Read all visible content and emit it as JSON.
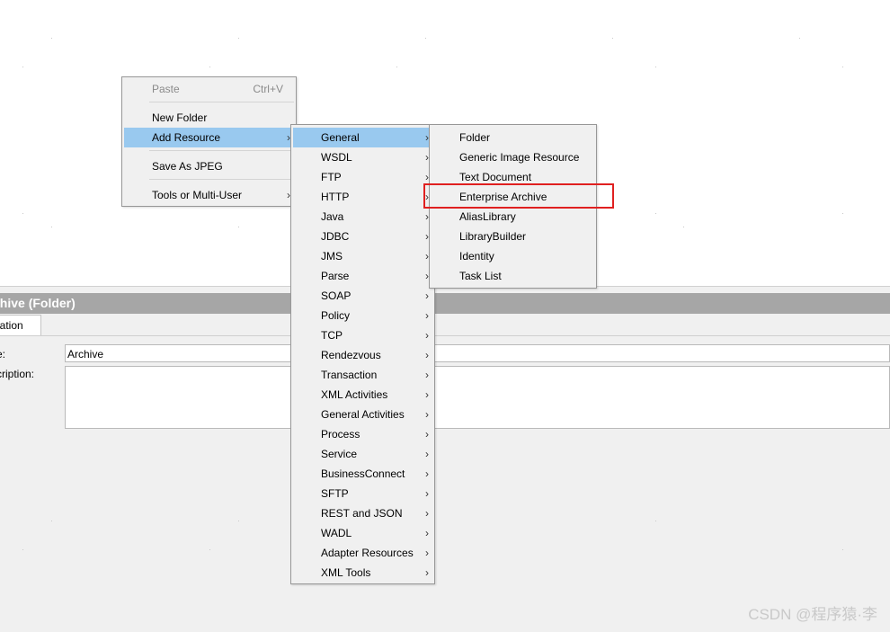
{
  "context_menu": {
    "paste": {
      "label": "Paste",
      "shortcut": "Ctrl+V"
    },
    "new_folder": "New Folder",
    "add_resource": "Add Resource",
    "save_as_jpeg": "Save As JPEG",
    "tools_multi_user": "Tools or Multi-User"
  },
  "resource_categories": [
    "General",
    "WSDL",
    "FTP",
    "HTTP",
    "Java",
    "JDBC",
    "JMS",
    "Parse",
    "SOAP",
    "Policy",
    "TCP",
    "Rendezvous",
    "Transaction",
    "XML Activities",
    "General Activities",
    "Process",
    "Service",
    "BusinessConnect",
    "SFTP",
    "REST and JSON",
    "WADL",
    "Adapter Resources",
    "XML Tools"
  ],
  "general_items": [
    "Folder",
    "Generic Image Resource",
    "Text Document",
    "Enterprise Archive",
    "AliasLibrary",
    "LibraryBuilder",
    "Identity",
    "Task List"
  ],
  "panel": {
    "header": "chive (Folder)",
    "tab": "uration",
    "name_label": "e:",
    "name_value": "Archive",
    "description_label": "cription:"
  },
  "watermark": "CSDN @程序猿·李",
  "colors": {
    "active_item": "#99c9ef",
    "highlight": "#e02020",
    "panel_header": "#a6a6a6"
  }
}
